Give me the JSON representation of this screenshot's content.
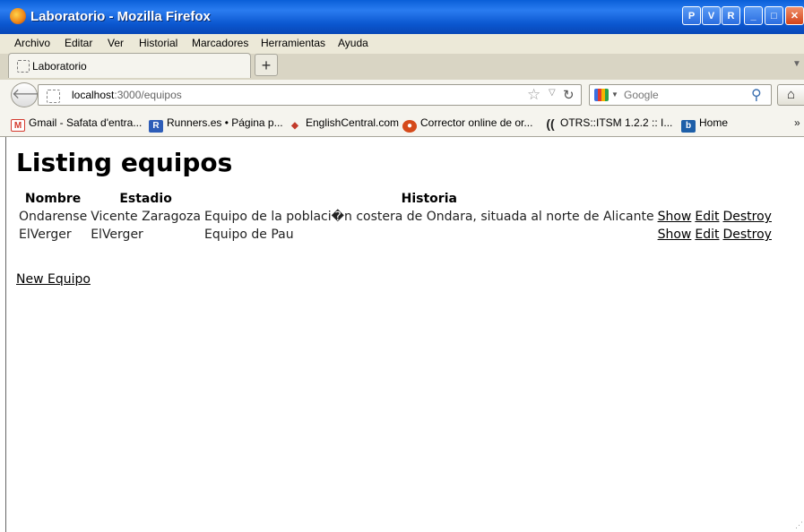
{
  "window": {
    "title": "Laboratorio - Mozilla Firefox"
  },
  "titlebar_buttons": [
    "P",
    "V",
    "R",
    "_",
    "□",
    "✕"
  ],
  "menu": [
    "Archivo",
    "Editar",
    "Ver",
    "Historial",
    "Marcadores",
    "Herramientas",
    "Ayuda"
  ],
  "tab": {
    "label": "Laboratorio",
    "new_tab": "+"
  },
  "navbar": {
    "url_host": "localhost",
    "url_path": ":3000/equipos",
    "search_placeholder": "Google"
  },
  "bookmarks": [
    {
      "label": "Gmail - Safata d'entra...",
      "icon": "gmail-icon"
    },
    {
      "label": "Runners.es • Página p...",
      "icon": "runners-icon"
    },
    {
      "label": "EnglishCentral.com",
      "icon": "englishcentral-icon"
    },
    {
      "label": "Corrector online de or...",
      "icon": "corrector-icon"
    },
    {
      "label": "OTRS::ITSM 1.2.2 :: I...",
      "icon": "otrs-icon"
    },
    {
      "label": "Home",
      "icon": "b-icon"
    }
  ],
  "page": {
    "title": "Listing equipos",
    "columns": [
      "Nombre",
      "Estadio",
      "Historia"
    ],
    "rows": [
      {
        "nombre": "Ondarense",
        "estadio": "Vicente Zaragoza",
        "historia": "Equipo de la poblaci�n costera de Ondara, situada al norte de Alicante"
      },
      {
        "nombre": "ElVerger",
        "estadio": "ElVerger",
        "historia": "Equipo de Pau"
      }
    ],
    "row_actions": [
      "Show",
      "Edit",
      "Destroy"
    ],
    "new_link": "New Equipo"
  }
}
